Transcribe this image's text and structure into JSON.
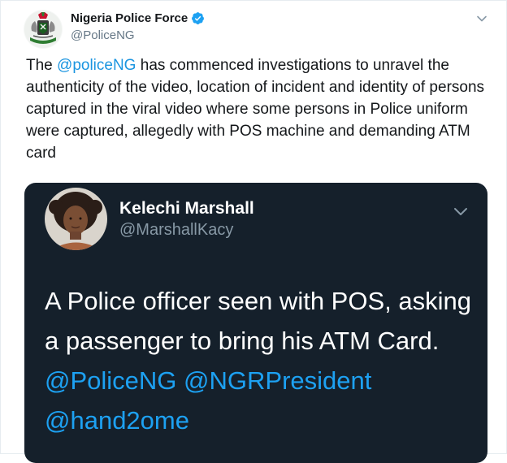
{
  "tweet": {
    "display_name": "Nigeria Police Force",
    "handle": "@PoliceNG",
    "text_prefix": "The ",
    "mention": "@policeNG",
    "text_rest": " has commenced investigations to unravel the authenticity of the video, location of incident and identity of persons captured in the viral video where some persons in Police uniform were captured, allegedly with POS machine and demanding ATM card",
    "icons": {
      "verified": "verified-badge-icon",
      "menu": "chevron-down-icon"
    },
    "colors": {
      "link": "#1b95e0",
      "verified": "#1da1f2"
    }
  },
  "quoted": {
    "display_name": "Kelechi Marshall",
    "handle": "@MarshallKacy",
    "text": "A Police officer seen with POS, asking a passenger to bring his ATM Card. ",
    "mentions": [
      "@PoliceNG",
      "@NGRPresident",
      "@hand2ome"
    ],
    "colors": {
      "background": "#15202b",
      "link": "#1da1f2"
    }
  }
}
